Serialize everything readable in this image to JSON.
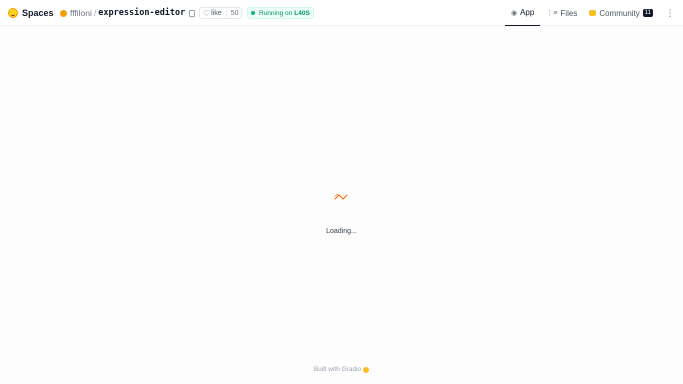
{
  "header": {
    "brand_label": "Spaces",
    "owner": "fffiloni",
    "separator": "/",
    "space_name": "expression-editor",
    "like_label": "like",
    "like_count": "50",
    "status_label": "Running on",
    "status_hardware": "L40S"
  },
  "nav": {
    "tabs": [
      {
        "label": "App",
        "icon": "app-icon",
        "active": true
      },
      {
        "label": "Files",
        "icon": "files-icon",
        "active": false
      },
      {
        "label": "Community",
        "icon": "community-icon",
        "active": false
      }
    ],
    "community_count": "11"
  },
  "main": {
    "loading_text": "Loading..."
  },
  "footer": {
    "built_with": "Built with Gradio"
  },
  "colors": {
    "accent_loader": "#f97316",
    "status_green": "#10b981",
    "brand_yellow": "#ffd21e"
  }
}
